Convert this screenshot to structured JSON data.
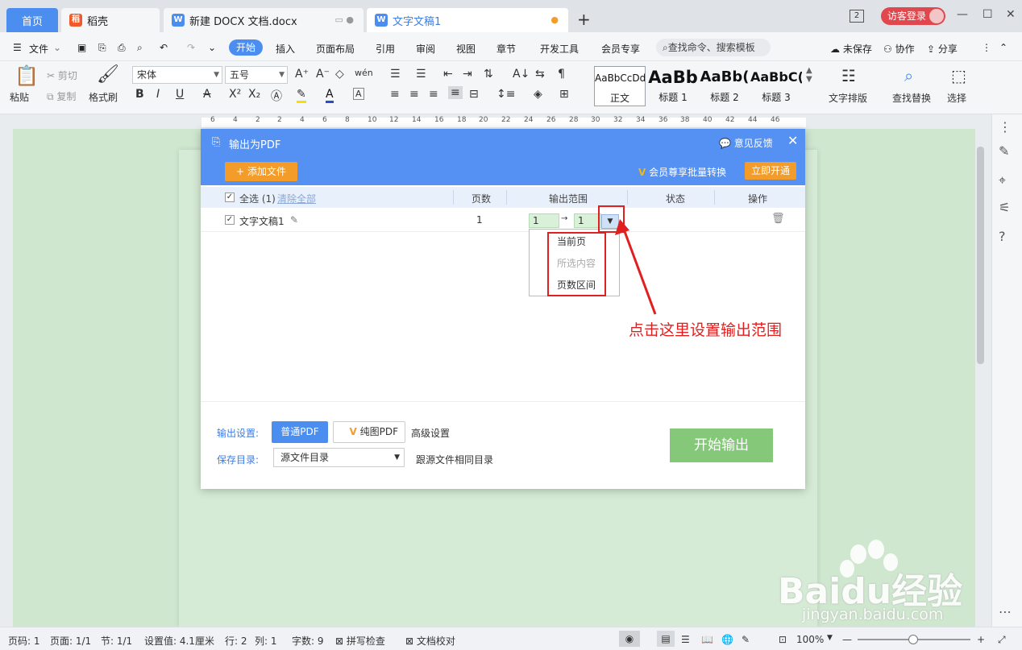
{
  "tabs": {
    "home": "首页",
    "daoke": "稻壳",
    "docx": "新建 DOCX 文档.docx",
    "doc1": "文字文稿1"
  },
  "titlebar": {
    "badge": "2",
    "login": "访客登录",
    "min": "—",
    "max": "☐",
    "close": "✕",
    "newtab": "+"
  },
  "menu": {
    "file": "文件",
    "start": "开始",
    "insert": "插入",
    "layout": "页面布局",
    "ref": "引用",
    "review": "审阅",
    "view": "视图",
    "chapter": "章节",
    "dev": "开发工具",
    "vip": "会员专享",
    "search": "查找命令、搜索模板",
    "unsaved": "未保存",
    "collab": "协作",
    "share": "分享"
  },
  "ribbon": {
    "paste": "粘贴",
    "cut": "剪切",
    "copy": "复制",
    "painter": "格式刷",
    "font": "宋体",
    "size": "五号",
    "style_sample1": "AaBbCcDd",
    "style_sample2": "AaBb",
    "style_sample3": "AaBb(",
    "style_sample4": "AaBbC(",
    "style_zw": "正文",
    "style_h1": "标题 1",
    "style_h2": "标题 2",
    "style_h3": "标题 3",
    "typeset": "文字排版",
    "findreplace": "查找替换",
    "select": "选择"
  },
  "ruler": {
    "ticks": [
      "6",
      "4",
      "2",
      "2",
      "4",
      "6",
      "8",
      "10",
      "12",
      "14",
      "16",
      "18",
      "20",
      "22",
      "24",
      "26",
      "28",
      "30",
      "32",
      "34",
      "36",
      "38",
      "40",
      "42",
      "44",
      "46"
    ]
  },
  "dialog": {
    "title": "输出为PDF",
    "feedback": "意见反馈",
    "add_file": "添加文件",
    "vip_batch": "会员尊享批量转换",
    "open_now": "立即开通",
    "headers": {
      "select_all": "全选 (1)",
      "clear_all": "清除全部",
      "pages": "页数",
      "range": "输出范围",
      "status": "状态",
      "action": "操作"
    },
    "row": {
      "name": "文字文稿1",
      "pages": "1",
      "from": "1",
      "arrow": "→",
      "to": "1"
    },
    "dropdown": {
      "current": "当前页",
      "selected": "所选内容",
      "range": "页数区间"
    },
    "annotation": "点击这里设置输出范围",
    "output_label": "输出设置:",
    "normal_pdf": "普通PDF",
    "image_pdf": "纯图PDF",
    "advanced": "高级设置",
    "save_label": "保存目录:",
    "save_dir": "源文件目录",
    "save_hint": "跟源文件相同目录",
    "start": "开始输出"
  },
  "status": {
    "page": "页码: 1",
    "pages": "页面: 1/1",
    "section": "节: 1/1",
    "setting": "设置值: 4.1厘米",
    "row": "行: 2",
    "col": "列: 1",
    "words": "字数: 9",
    "spell": "拼写检查",
    "proof": "文档校对",
    "zoom": "100%"
  },
  "watermark": {
    "brand": "Baidu经验",
    "url": "jingyan.baidu.com"
  },
  "colors": {
    "accent": "#4b8ef0",
    "orange": "#f39c2a",
    "red": "#e02020",
    "green": "#85c87a"
  }
}
